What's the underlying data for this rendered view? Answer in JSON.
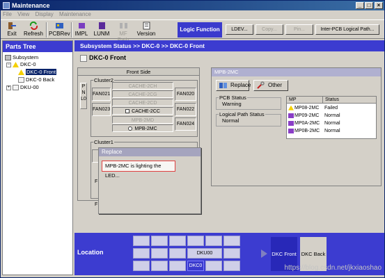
{
  "window": {
    "title": "Maintenance"
  },
  "menu": [
    "File",
    "View",
    "Display",
    "Maintenance"
  ],
  "toolbar": {
    "exit": "Exit",
    "refresh": "Refresh",
    "pcbrev": "PCBRev",
    "impl": "IMPL",
    "lunm": "LUNM",
    "mfpath": "MF Path",
    "version": "Version",
    "logic_function": "Logic Function",
    "ldev": "LDEV...",
    "copy": "Copy...",
    "pin": "Pin...",
    "interpcb": "Inter-PCB Logical Path..."
  },
  "parts_tree": {
    "title": "Parts Tree",
    "nodes": {
      "subsystem": "Subsystem",
      "dkc0": "DKC-0",
      "dkc0_front": "DKC-0 Front",
      "dkc0_back": "DKC-0 Back",
      "dku00": "DKU-00"
    }
  },
  "breadcrumb": "Subsystem Status  >>  DKC-0  >>  DKC-0 Front",
  "page_title": "DKC-0 Front",
  "front_panel": {
    "header": "Front Side",
    "pnl": "PNL0",
    "cluster2": {
      "label": "Cluster2",
      "fan021": "FAN021",
      "fan023": "FAN023",
      "fan020": "FAN020",
      "fan022": "FAN022",
      "fan024": "FAN024",
      "cache2ch": "CACHE-2CH",
      "cache2cg": "CACHE-2CG",
      "cache2cd": "CACHE-2CD",
      "cache2cc": "CACHE-2CC",
      "mpb2md": "MPB-2MD",
      "mpb2mc": "MPB-2MC"
    },
    "cluster1": {
      "label": "Cluster1"
    }
  },
  "mpb_panel": {
    "title": "MPB-2MC",
    "replace": "Replace",
    "other": "Other",
    "pcb_status_label": "PCB Status",
    "pcb_status_value": "Warning",
    "logical_path_label": "Logical Path Status",
    "logical_path_value": "Normal",
    "table": {
      "headers": [
        "MP",
        "Status"
      ],
      "rows": [
        {
          "mp": "MP08-2MC",
          "status": "Failed",
          "icon": "warning-icon"
        },
        {
          "mp": "MP09-2MC",
          "status": "Normal",
          "icon": "mp-icon"
        },
        {
          "mp": "MP0A-2MC",
          "status": "Normal",
          "icon": "mp-icon"
        },
        {
          "mp": "MP0B-2MC",
          "status": "Normal",
          "icon": "mp-icon"
        }
      ]
    }
  },
  "replace_dialog": {
    "title": "Replace",
    "message": "MPB-2MC is lighting the LED...",
    "side_letters": [
      "F",
      "F",
      "F"
    ]
  },
  "location": {
    "label": "Location",
    "dku00": "DKU00",
    "dkc0": "DKC0",
    "dkc_front": "DKC Front",
    "dkc_back": "DKC Back"
  },
  "watermark": "https://blog.csdn.net/jkxiaoshao",
  "colors": {
    "accent_blue": "#3c3cd0",
    "titlebar": "#0a246a",
    "failed_border": "#e04040"
  }
}
